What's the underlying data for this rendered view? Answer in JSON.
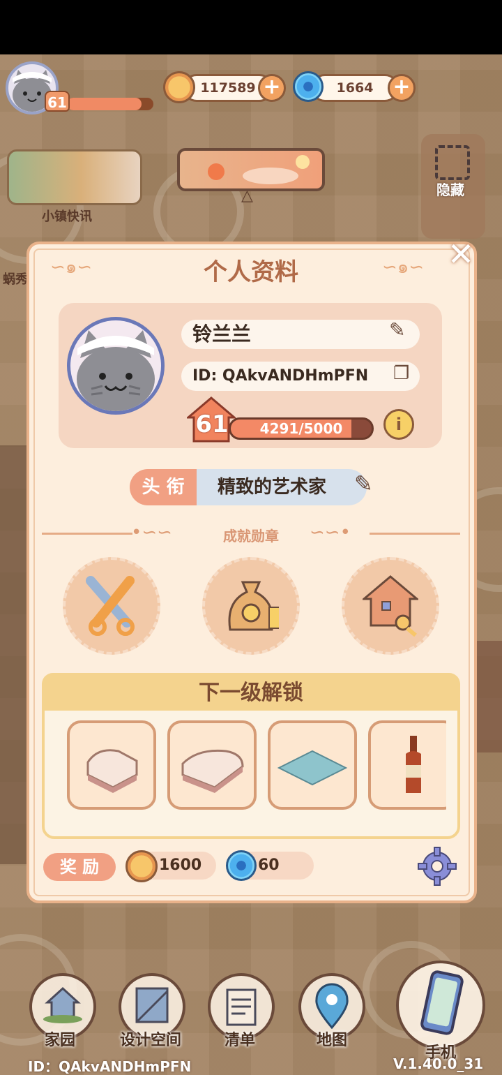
{
  "hud": {
    "player_level": "61",
    "player_xp_fraction": 0.86,
    "coins": "117589",
    "gems": "1664",
    "plus_symbol": "+",
    "news_label": "小镇快讯",
    "hide_label": "隐藏",
    "side_partial_label": "蜗秀"
  },
  "profile": {
    "title": "个人资料",
    "close_symbol": "✕",
    "name": "铃兰兰",
    "id": "ID: QAkvANDHmPFN",
    "level": "61",
    "xp": "4291/5000",
    "xp_fraction": 0.858,
    "info_symbol": "i",
    "title_tag": "头 衔",
    "title_value": "精致的艺术家",
    "achievements_label": "成就勋章",
    "achievements": [
      {
        "icon": "scissors-icon"
      },
      {
        "icon": "money-bag-icon"
      },
      {
        "icon": "house-key-icon"
      }
    ],
    "next_unlock_label": "下一级解锁",
    "unlock_items": [
      {
        "icon": "chair-icon"
      },
      {
        "icon": "sofa-icon"
      },
      {
        "icon": "rug-icon"
      },
      {
        "icon": "bottle-icon"
      }
    ],
    "reward_label": "奖 励",
    "reward_coins": "1600",
    "reward_gems": "60"
  },
  "nav": {
    "items": [
      {
        "label": "家园",
        "icon": "home-icon"
      },
      {
        "label": "设计空间",
        "icon": "design-icon"
      },
      {
        "label": "清单",
        "icon": "list-icon"
      },
      {
        "label": "地图",
        "icon": "map-pin-icon"
      },
      {
        "label": "手机",
        "icon": "phone-icon"
      }
    ]
  },
  "footer": {
    "id_text": "ID：QAkvANDHmPFN",
    "version": "V.1.40.0_31"
  },
  "colors": {
    "panel_bg": "#fdeedd",
    "accent": "#f1a083",
    "title_text": "#b06a48"
  }
}
